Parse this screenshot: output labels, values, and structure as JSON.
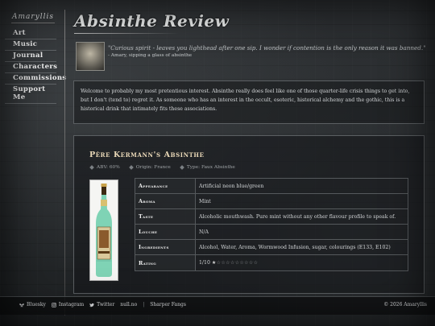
{
  "sidebar": {
    "logo": "Amaryllis",
    "items": [
      {
        "label": "Art"
      },
      {
        "label": "Music"
      },
      {
        "label": "Journal"
      },
      {
        "label": "Characters"
      },
      {
        "label": "Commissions"
      },
      {
        "label": "Support Me"
      }
    ]
  },
  "header": {
    "title": "Absinthe Review"
  },
  "quote": {
    "text": "\"Curious spirit - leaves you lighthead after one sip. I wonder if contention is the only reason it was banned.\"",
    "attribution": "- Amary, sipping a glass of absinthe"
  },
  "intro": {
    "text": "Welcome to probably my most pretentious interest. Absinthe really does feel like one of those quarter-life crisis things to get into, but I don't (tend to) regret it. As someone who has an interest in the occult, esoteric, historical alchemy and the gothic, this is a historical drink that intimately fits these associations."
  },
  "product": {
    "name": "Père Kermann's Absinthe",
    "abv": "ABV: 60%",
    "origin": "Origin: France",
    "type": "Type: Faux Absinthe",
    "rows": [
      {
        "label": "Appearance",
        "value": "Artificial neon blue/green"
      },
      {
        "label": "Aroma",
        "value": "Mint"
      },
      {
        "label": "Taste",
        "value": "Alcoholic mouthwash. Pure mint without any other flavour profile to speak of."
      },
      {
        "label": "Louche",
        "value": "N/A"
      },
      {
        "label": "Ingredients",
        "value": "Alcohol, Water, Aroma, Wormwood Infusion, sugar, colourings (E133, E102)"
      },
      {
        "label": "Rating",
        "value": "1/10"
      }
    ],
    "rating": {
      "score": 1,
      "max": 10
    }
  },
  "footer": {
    "links": [
      {
        "label": "Bluesky",
        "icon": "butterfly-icon"
      },
      {
        "label": "Instagram",
        "icon": "instagram-icon"
      },
      {
        "label": "Twitter",
        "icon": "twitter-icon"
      },
      {
        "label": "null.no",
        "icon": ""
      },
      {
        "label": "Sharper Fangs",
        "icon": ""
      }
    ],
    "separator": "|",
    "copyright": "© 2026 Amaryllis"
  },
  "colors": {
    "background": "#26292b",
    "accent_title": "#ead9b8",
    "border": "#5b5f62",
    "bottle_liquid": "#7fd3b5"
  }
}
